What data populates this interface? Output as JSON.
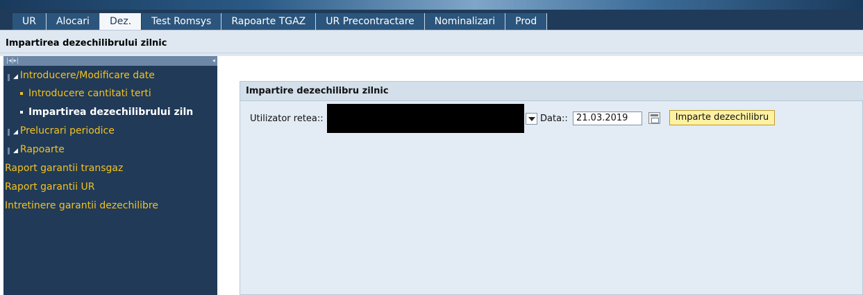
{
  "tabs": [
    {
      "label": "UR"
    },
    {
      "label": "Alocari"
    },
    {
      "label": "Dez."
    },
    {
      "label": "Test Romsys"
    },
    {
      "label": "Rapoarte TGAZ"
    },
    {
      "label": "UR Precontractare"
    },
    {
      "label": "Nominalizari"
    },
    {
      "label": "Prod"
    }
  ],
  "active_tab": "Dez.",
  "page_title": "Impartirea dezechilibrului zilnic",
  "nav": {
    "items": [
      {
        "label": "Introducere/Modificare date"
      },
      {
        "label": "Introducere cantitati terti"
      },
      {
        "label": "Impartirea dezechilibrului ziln"
      },
      {
        "label": "Prelucrari periodice"
      },
      {
        "label": "Rapoarte"
      },
      {
        "label": "Raport garantii transgaz"
      },
      {
        "label": "Raport garantii UR"
      },
      {
        "label": "Intretinere garantii dezechilibre"
      }
    ]
  },
  "panel": {
    "title": "Impartire dezechilibru zilnic",
    "user_label": "Utilizator retea::",
    "date_label": "Data::",
    "date_value": "21.03.2019",
    "action_label": "Imparte dezechilibru"
  },
  "colors": {
    "nav_bg": "#203a58",
    "nav_text": "#f4c21f",
    "tabbar_bg": "#1f3b59",
    "panel_bg": "#e3ebf4",
    "action_bg": "#fef2a2"
  }
}
